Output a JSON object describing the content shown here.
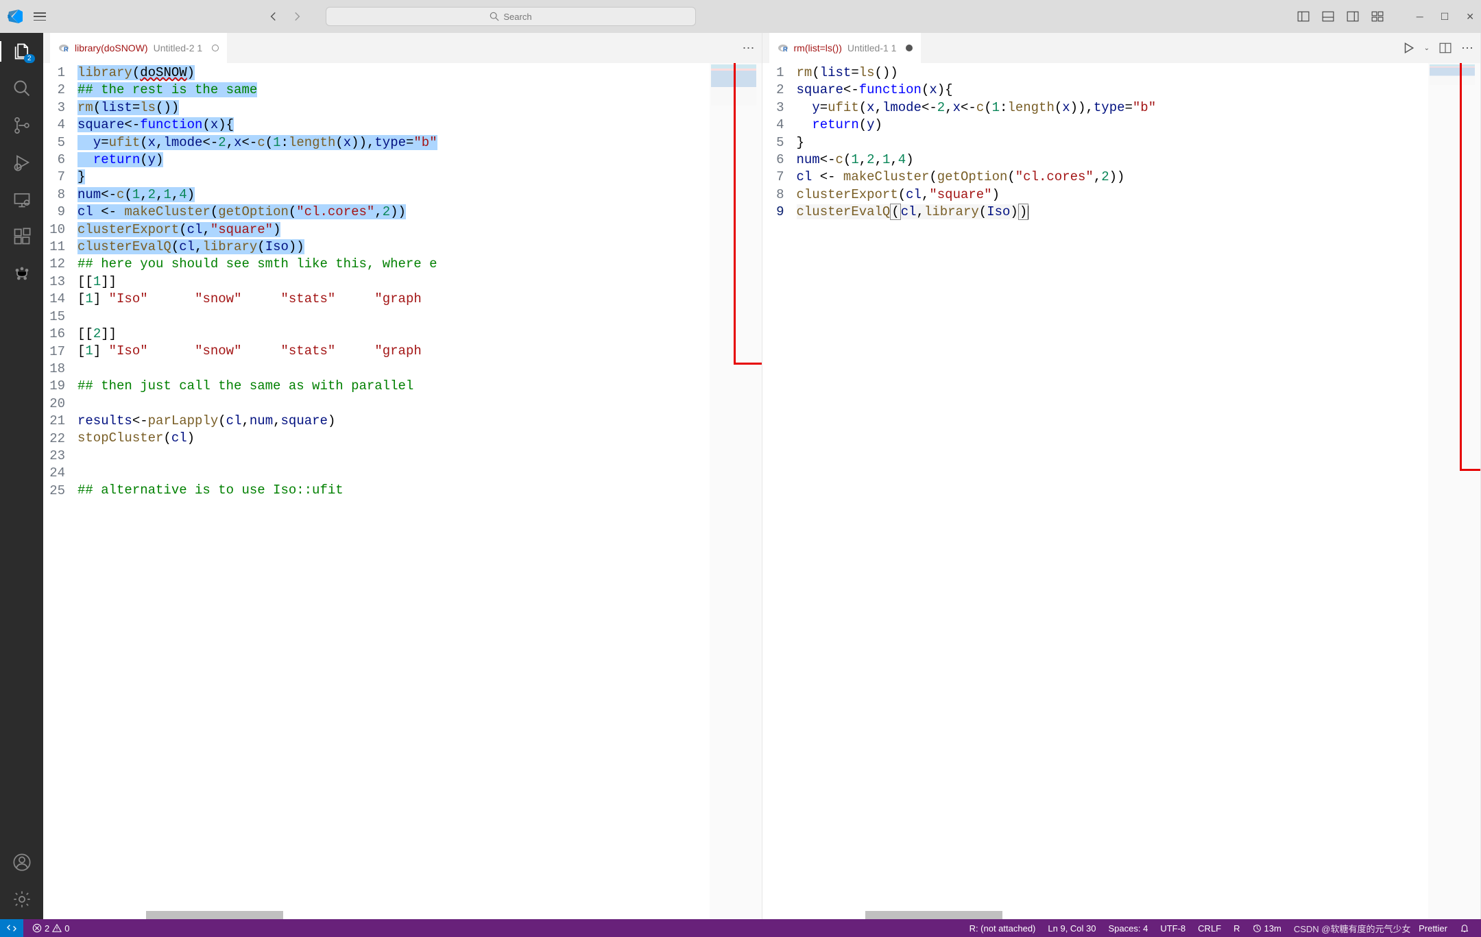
{
  "search": {
    "placeholder": "Search"
  },
  "activity": {
    "explorer_badge": "2"
  },
  "editor_left": {
    "tab_title": "library(doSNOW)",
    "tab_desc": "Untitled-2 1",
    "lines": [
      {
        "n": 1,
        "html": "<span class='sel'><span class='k-call'>library</span>(<span class='wavy'>doSNOW</span>)</span>"
      },
      {
        "n": 2,
        "html": "<span class='sel'><span class='k-green'>## the rest is the same</span></span>"
      },
      {
        "n": 3,
        "html": "<span class='sel'><span class='k-call'>rm</span>(<span class='k-purple'>list</span>=<span class='k-call'>ls</span>())</span>"
      },
      {
        "n": 4,
        "html": "<span class='sel'><span class='k-purple'>square</span>&lt;-<span class='k-blue'>function</span>(<span class='k-purple'>x</span>){</span>"
      },
      {
        "n": 5,
        "html": "<span class='sel'>&nbsp;&nbsp;<span class='k-purple'>y</span>=<span class='k-call'>ufit</span>(<span class='k-purple'>x</span>,<span class='k-purple'>lmode</span>&lt;-<span class='k-num'>2</span>,<span class='k-purple'>x</span>&lt;-<span class='k-call'>c</span>(<span class='k-num'>1</span>:<span class='k-call'>length</span>(<span class='k-purple'>x</span>)),<span class='k-purple'>type</span>=<span class='k-str'>\"b\"</span></span>"
      },
      {
        "n": 6,
        "html": "<span class='sel'>&nbsp;&nbsp;<span class='k-blue'>return</span>(<span class='k-purple'>y</span>)</span>"
      },
      {
        "n": 7,
        "html": "<span class='sel'>}</span>"
      },
      {
        "n": 8,
        "html": "<span class='sel'><span class='k-purple'>num</span>&lt;-<span class='k-call'>c</span>(<span class='k-num'>1</span>,<span class='k-num'>2</span>,<span class='k-num'>1</span>,<span class='k-num'>4</span>)</span>"
      },
      {
        "n": 9,
        "html": "<span class='sel'><span class='k-purple'>cl</span> &lt;- <span class='k-call'>makeCluster</span>(<span class='k-call'>getOption</span>(<span class='k-str'>\"cl.cores\"</span>,<span class='k-num'>2</span>))</span>"
      },
      {
        "n": 10,
        "html": "<span class='sel'><span class='k-call'>clusterExport</span>(<span class='k-purple'>cl</span>,<span class='k-str'>\"square\"</span>)</span>"
      },
      {
        "n": 11,
        "html": "<span class='sel'><span class='k-call'>clusterEvalQ</span>(<span class='k-purple'>cl</span>,<span class='k-call'>library</span>(<span class='k-purple'>Iso</span>))</span>"
      },
      {
        "n": 12,
        "html": "<span class='k-green'>## here you should see smth like this, where e</span>"
      },
      {
        "n": 13,
        "html": "[[<span class='k-num'>1</span>]]"
      },
      {
        "n": 14,
        "html": "[<span class='k-num'>1</span>] <span class='k-str'>\"Iso\"</span>&nbsp;&nbsp;&nbsp;&nbsp;&nbsp;&nbsp;<span class='k-str'>\"snow\"</span>&nbsp;&nbsp;&nbsp;&nbsp;&nbsp;<span class='k-str'>\"stats\"</span>&nbsp;&nbsp;&nbsp;&nbsp;&nbsp;<span class='k-str'>\"graph</span>"
      },
      {
        "n": 15,
        "html": ""
      },
      {
        "n": 16,
        "html": "[[<span class='k-num'>2</span>]]"
      },
      {
        "n": 17,
        "html": "[<span class='k-num'>1</span>] <span class='k-str'>\"Iso\"</span>&nbsp;&nbsp;&nbsp;&nbsp;&nbsp;&nbsp;<span class='k-str'>\"snow\"</span>&nbsp;&nbsp;&nbsp;&nbsp;&nbsp;<span class='k-str'>\"stats\"</span>&nbsp;&nbsp;&nbsp;&nbsp;&nbsp;<span class='k-str'>\"graph</span>"
      },
      {
        "n": 18,
        "html": ""
      },
      {
        "n": 19,
        "html": "<span class='k-green'>## then just call the same as with parallel</span>"
      },
      {
        "n": 20,
        "html": ""
      },
      {
        "n": 21,
        "html": "<span class='k-purple'>results</span>&lt;-<span class='k-call'>parLapply</span>(<span class='k-purple'>cl</span>,<span class='k-purple'>num</span>,<span class='k-purple'>square</span>)"
      },
      {
        "n": 22,
        "html": "<span class='k-call'>stopCluster</span>(<span class='k-purple'>cl</span>)"
      },
      {
        "n": 23,
        "html": ""
      },
      {
        "n": 24,
        "html": ""
      },
      {
        "n": 25,
        "html": "<span class='k-green'>## alternative is to use Iso::ufit</span>"
      }
    ]
  },
  "editor_right": {
    "tab_title": "rm(list=ls())",
    "tab_desc": "Untitled-1 1",
    "lines": [
      {
        "n": 1,
        "html": "<span class='k-call'>rm</span>(<span class='k-purple'>list</span>=<span class='k-call'>ls</span>())"
      },
      {
        "n": 2,
        "html": "<span class='k-purple'>square</span>&lt;-<span class='k-blue'>function</span>(<span class='k-purple'>x</span>){"
      },
      {
        "n": 3,
        "html": "&nbsp;&nbsp;<span class='k-purple'>y</span>=<span class='k-call'>ufit</span>(<span class='k-purple'>x</span>,<span class='k-purple'>lmode</span>&lt;-<span class='k-num'>2</span>,<span class='k-purple'>x</span>&lt;-<span class='k-call'>c</span>(<span class='k-num'>1</span>:<span class='k-call'>length</span>(<span class='k-purple'>x</span>)),<span class='k-purple'>type</span>=<span class='k-str'>\"b\"</span>"
      },
      {
        "n": 4,
        "html": "&nbsp;&nbsp;<span class='k-blue'>return</span>(<span class='k-purple'>y</span>)"
      },
      {
        "n": 5,
        "html": "}"
      },
      {
        "n": 6,
        "html": "<span class='k-purple'>num</span>&lt;-<span class='k-call'>c</span>(<span class='k-num'>1</span>,<span class='k-num'>2</span>,<span class='k-num'>1</span>,<span class='k-num'>4</span>)"
      },
      {
        "n": 7,
        "html": "<span class='k-purple'>cl</span> &lt;- <span class='k-call'>makeCluster</span>(<span class='k-call'>getOption</span>(<span class='k-str'>\"cl.cores\"</span>,<span class='k-num'>2</span>))"
      },
      {
        "n": 8,
        "html": "<span class='k-call'>clusterExport</span>(<span class='k-purple'>cl</span>,<span class='k-str'>\"square\"</span>)"
      },
      {
        "n": 9,
        "html": "<span class='cur-line'><span class='k-call'>clusterEvalQ</span><span style='border:1px solid #888;padding:0 1px'>(</span><span class='k-purple'>cl</span>,<span class='k-call'>library</span>(<span class='k-purple'>Iso</span>)<span style='border:1px solid #888;padding:0 1px'>)</span><span class='cursor'></span></span>"
      }
    ]
  },
  "statusbar": {
    "errors": "2",
    "warnings": "0",
    "r_status": "R: (not attached)",
    "cursor": "Ln 9, Col 30",
    "spaces": "Spaces: 4",
    "encoding": "UTF-8",
    "eol": "CRLF",
    "lang": "R",
    "time": "13m",
    "prettier": "Prettier",
    "watermark": "CSDN @软糖有度的元气少女"
  }
}
